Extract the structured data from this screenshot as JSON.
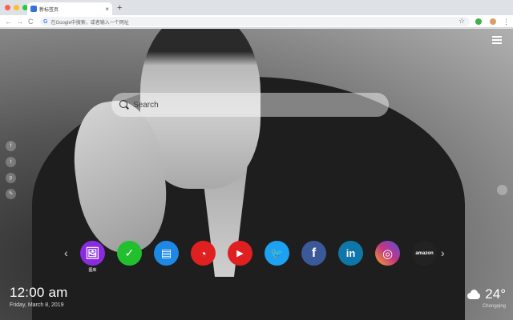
{
  "browser": {
    "tab_title": "新标签页",
    "tab_close": "×",
    "new_tab": "+",
    "back": "←",
    "forward": "→",
    "reload": "C",
    "google_glyph": "G",
    "omnibox_placeholder": "在Google中搜索，或者输入一个网址",
    "star": "☆",
    "kebab": "⋮"
  },
  "search": {
    "placeholder": "Search"
  },
  "side_social": [
    {
      "icon": "facebook-icon",
      "glyph": "f"
    },
    {
      "icon": "twitter-icon",
      "glyph": "t"
    },
    {
      "icon": "pinterest-icon",
      "glyph": "p"
    },
    {
      "icon": "share-icon",
      "glyph": "✎"
    }
  ],
  "apps": [
    {
      "icon": "gallery-icon",
      "glyph": "🖼",
      "color": "#8a2be2",
      "label": "图库"
    },
    {
      "icon": "task-check-icon",
      "glyph": "✓",
      "color": "#22c02e",
      "label": ""
    },
    {
      "icon": "news-icon",
      "glyph": "▤",
      "color": "#1e88e5",
      "label": ""
    },
    {
      "icon": "game-icon",
      "glyph": "◔",
      "color": "#e02020",
      "label": ""
    },
    {
      "icon": "youtube-icon",
      "glyph": "▶",
      "color": "#e02020",
      "label": ""
    },
    {
      "icon": "twitter-icon",
      "glyph": "🐦",
      "color": "#1da1f2",
      "label": ""
    },
    {
      "icon": "facebook-icon",
      "glyph": "f",
      "color": "#3b5998",
      "label": ""
    },
    {
      "icon": "linkedin-icon",
      "glyph": "in",
      "color": "#0e76a8",
      "label": ""
    },
    {
      "icon": "instagram-icon",
      "glyph": "◎",
      "color": "#c13584",
      "label": ""
    },
    {
      "icon": "amazon-icon",
      "glyph": "amazon",
      "color": "#222222",
      "label": ""
    }
  ],
  "arrows": {
    "prev": "‹",
    "next": "›"
  },
  "clock": {
    "time": "12:00 am",
    "date": "Friday, March 8, 2019"
  },
  "weather": {
    "temperature": "24°",
    "city": "Chongqing"
  }
}
